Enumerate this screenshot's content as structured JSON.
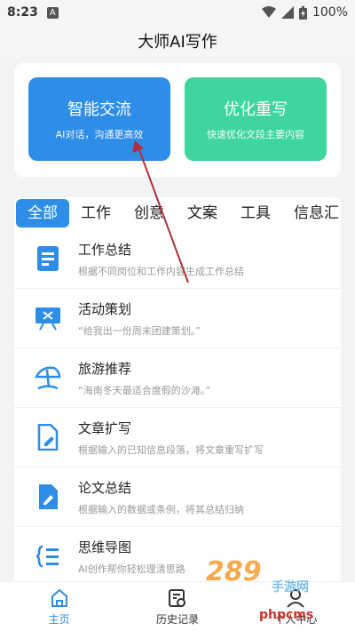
{
  "status_bar": {
    "time": "8:23",
    "notif_letter": "A",
    "battery": "100%"
  },
  "header": {
    "title": "大师AI写作"
  },
  "features": [
    {
      "title": "智能交流",
      "subtitle": "AI对话，沟通更高效",
      "color": "#2e8de6"
    },
    {
      "title": "优化重写",
      "subtitle": "快速优化文段主要内容",
      "color": "#3fd69e"
    }
  ],
  "tabs": [
    "全部",
    "工作",
    "创意",
    "文案",
    "工具",
    "信息汇"
  ],
  "list": [
    {
      "title": "工作总结",
      "desc": "根据不同岗位和工作内容生成工作总结",
      "icon": "document-icon"
    },
    {
      "title": "活动策划",
      "desc": "“给我出一份周末团建策划。”",
      "icon": "presentation-icon"
    },
    {
      "title": "旅游推荐",
      "desc": "“海南冬天最适合度假的沙滩。”",
      "icon": "beach-umbrella-icon"
    },
    {
      "title": "文章扩写",
      "desc": "根据输入的已知信息段落，将文章重写扩写",
      "icon": "edit-document-icon"
    },
    {
      "title": "论文总结",
      "desc": "根据输入的数据或条例，将其总结归纳",
      "icon": "pen-document-icon"
    },
    {
      "title": "思维导图",
      "desc": "AI创作帮你轻松理清思路",
      "icon": "mindmap-icon"
    }
  ],
  "nav": [
    {
      "label": "主页",
      "icon": "home-icon"
    },
    {
      "label": "历史记录",
      "icon": "history-icon"
    },
    {
      "label": "个人中心",
      "icon": "user-icon"
    }
  ],
  "watermark": {
    "brand": "289",
    "brand_sub": "手游网",
    "site": "phpcms"
  },
  "colors": {
    "accent": "#2e8de6",
    "green": "#3fd69e",
    "arrow": "#b0303a"
  }
}
